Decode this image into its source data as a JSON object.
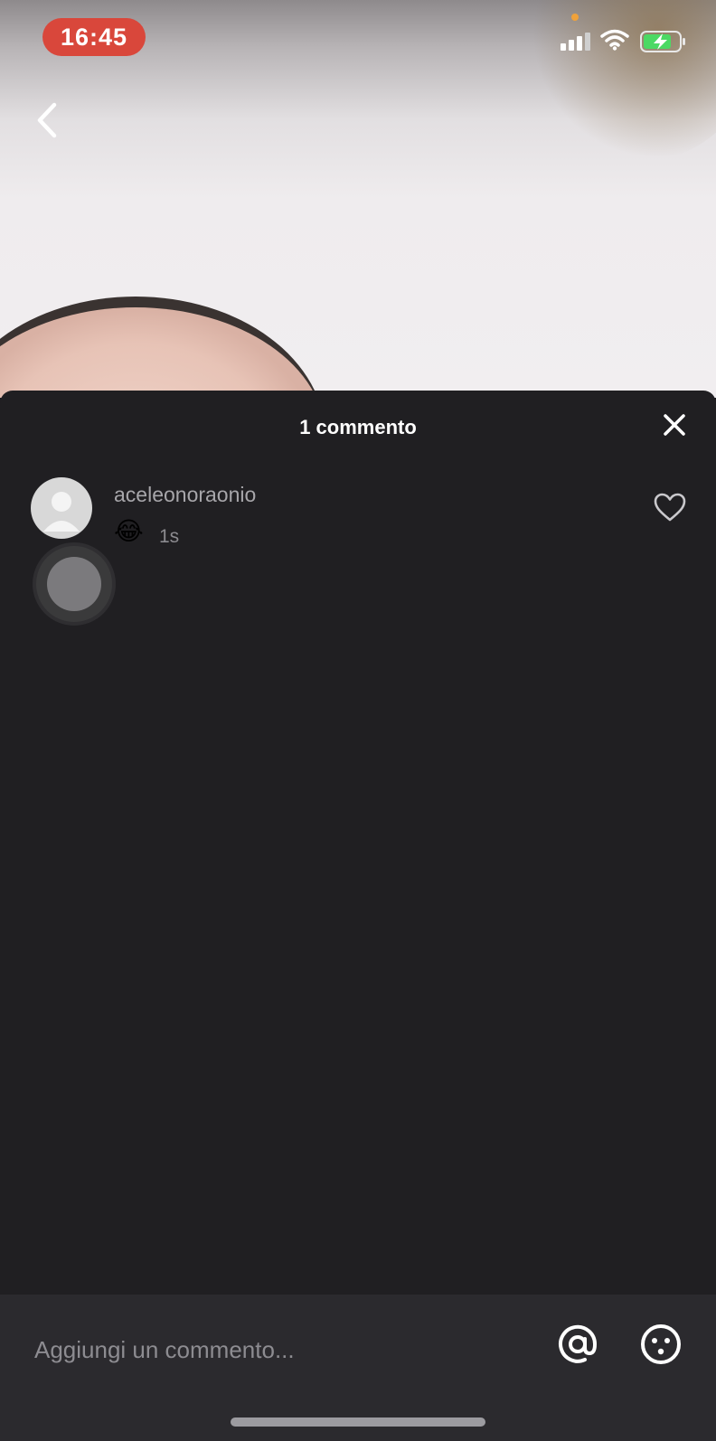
{
  "status_bar": {
    "time": "16:45"
  },
  "comments_sheet": {
    "title": "1 commento",
    "comments": [
      {
        "username": "aceleonoraonio",
        "text": "😂",
        "time": "1s"
      }
    ]
  },
  "input_bar": {
    "placeholder": "Aggiungi un commento..."
  },
  "colors": {
    "time_pill": "#d9473b",
    "sheet_bg": "#201f22",
    "input_bar_bg": "#2b2a2e",
    "battery_green": "#4cd964"
  }
}
